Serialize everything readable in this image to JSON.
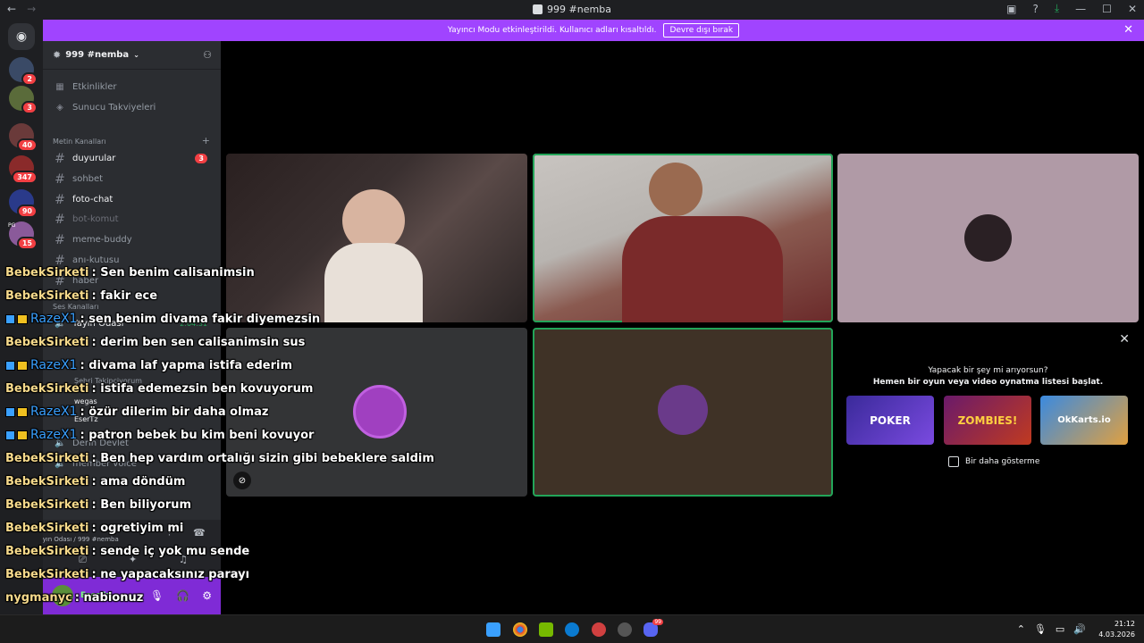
{
  "window": {
    "title": "999 #nemba",
    "back_icon": "←",
    "forward_icon": "→"
  },
  "banner": {
    "message": "Yayıncı Modu etkinleştirildi. Kullanıcı adları kısaltıldı.",
    "button": "Devre dışı bırak"
  },
  "guilds": {
    "badges": [
      "2",
      "3",
      "40",
      "347",
      "90",
      "15"
    ],
    "label_pg": "PG"
  },
  "server": {
    "name": "999 #nemba",
    "menu": [
      "Etkinlikler",
      "Sunucu Takviyeleri"
    ],
    "text_category": "Metin Kanalları",
    "voice_category": "Ses Kanalları",
    "channels": [
      {
        "name": "duyurular",
        "badge": "3"
      },
      {
        "name": "sohbet"
      },
      {
        "name": "foto-chat"
      },
      {
        "name": "bot-komut"
      },
      {
        "name": "meme-buddy"
      },
      {
        "name": "anı-kutusu"
      },
      {
        "name": "haber"
      }
    ],
    "voice_channel": "Yayın Odası",
    "voice_timer": "2:04:31",
    "voice_users": [
      "Şehri Takipçiyorum",
      "wegas",
      "EserTz"
    ],
    "voice_channel2": "Derin Devlet",
    "voice_channel3": "member voice",
    "voice_status": "Yayın Odası / 999 #nemba"
  },
  "user": {
    "name": "EserTz"
  },
  "activity": {
    "line1": "Yapacak bir şey mi arıyorsun?",
    "line2": "Hemen bir oyun veya video oynatma listesi başlat.",
    "games": [
      "POKER",
      "ZOMBIES!",
      "OkKarts.io"
    ],
    "dont_show": "Bir daha gösterme"
  },
  "chat": [
    {
      "user": "BebekSirketi",
      "type": "b",
      "text": ": Sen benim calisanimsin"
    },
    {
      "user": "BebekSirketi",
      "type": "b",
      "text": ": fakir ece"
    },
    {
      "user": "RazeX1",
      "type": "r",
      "text": ": sen benim divama fakir diyemezsin"
    },
    {
      "user": "BebekSirketi",
      "type": "b",
      "text": ": derim ben sen calisanimsin sus"
    },
    {
      "user": "RazeX1",
      "type": "r",
      "text": ": divama laf yapma istifa ederim"
    },
    {
      "user": "BebekSirketi",
      "type": "b",
      "text": ": istifa edemezsin ben kovuyorum"
    },
    {
      "user": "RazeX1",
      "type": "r",
      "text": ": özür dilerim bir daha olmaz"
    },
    {
      "user": "RazeX1",
      "type": "r",
      "text": ": patron bebek bu kim beni kovuyor"
    },
    {
      "user": "BebekSirketi",
      "type": "b",
      "text": ": Ben hep vardım ortalığı sizin gibi bebeklere saldim"
    },
    {
      "user": "BebekSirketi",
      "type": "b",
      "text": ": ama döndüm"
    },
    {
      "user": "BebekSirketi",
      "type": "b",
      "text": ": Ben biliyorum"
    },
    {
      "user": "BebekSirketi",
      "type": "b",
      "text": ": ogretiyim mi"
    },
    {
      "user": "BebekSirketi",
      "type": "b",
      "text": ": sende iç yok mu sende"
    },
    {
      "user": "BebekSirketi",
      "type": "b",
      "text": ": ne yapacaksınız parayı"
    },
    {
      "user": "nygmanyc",
      "type": "b",
      "text": ": nabionuz"
    }
  ],
  "taskbar": {
    "time": "21:12",
    "date": "4.03.2026",
    "discord_badge": "99"
  },
  "colors": {
    "banner": "#a044ff",
    "speaking": "#23a559",
    "bebek": "#f5d98b",
    "raze": "#3aa0ff"
  }
}
